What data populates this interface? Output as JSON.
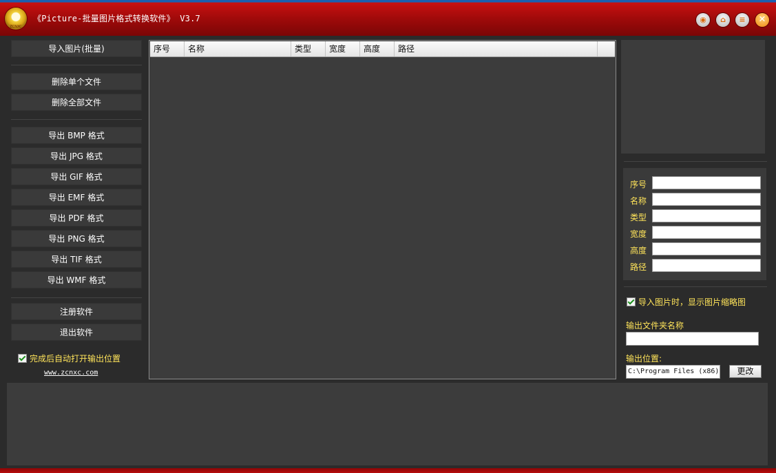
{
  "window": {
    "title": "《Picture-批量图片格式转换软件》 V3.7",
    "logo_text": "ZCNXC"
  },
  "window_controls": {
    "help_icon": "◉",
    "home_icon": "⌂",
    "menu_icon": "≡",
    "close_icon": "✕"
  },
  "sidebar": {
    "import_label": "导入图片(批量)",
    "delete_one_label": "删除单个文件",
    "delete_all_label": "删除全部文件",
    "export_bmp": "导出 BMP 格式",
    "export_jpg": "导出 JPG 格式",
    "export_gif": "导出 GIF 格式",
    "export_emf": "导出 EMF 格式",
    "export_pdf": "导出 PDF 格式",
    "export_png": "导出 PNG 格式",
    "export_tif": "导出 TIF 格式",
    "export_wmf": "导出 WMF 格式",
    "register_label": "注册软件",
    "exit_label": "退出软件",
    "auto_open_label": "完成后自动打开输出位置",
    "auto_open_checked": true,
    "website": "www.zcnxc.com"
  },
  "file_table": {
    "columns": [
      "序号",
      "名称",
      "类型",
      "宽度",
      "高度",
      "路径"
    ],
    "rows": []
  },
  "info_panel": {
    "fields": [
      {
        "label": "序号",
        "value": ""
      },
      {
        "label": "名称",
        "value": ""
      },
      {
        "label": "类型",
        "value": ""
      },
      {
        "label": "宽度",
        "value": ""
      },
      {
        "label": "高度",
        "value": ""
      },
      {
        "label": "路径",
        "value": ""
      }
    ]
  },
  "options": {
    "show_thumbnail_label": "导入图片时，显示图片缩略图",
    "show_thumbnail_checked": true,
    "output_folder_label": "输出文件夹名称",
    "output_folder_value": "",
    "output_location_label": "输出位置:",
    "output_location_value": "C:\\Program Files (x86)",
    "change_button_label": "更改"
  }
}
